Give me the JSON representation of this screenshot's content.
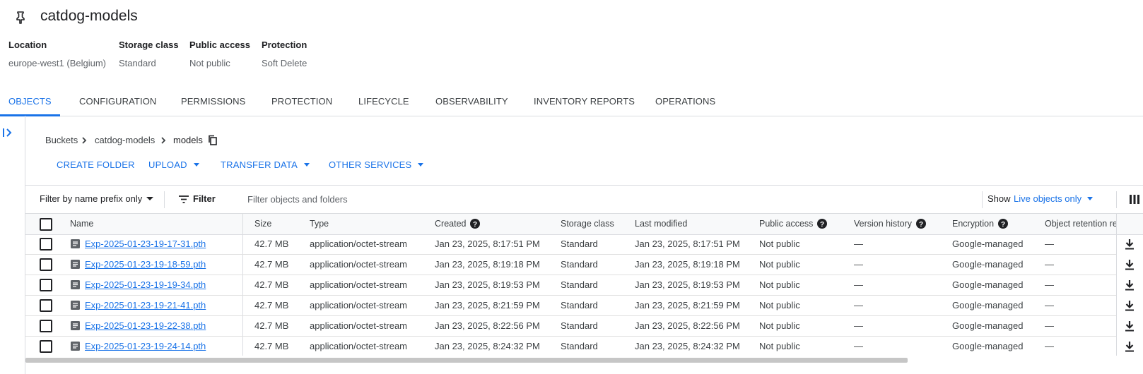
{
  "bucket": {
    "name": "catdog-models",
    "meta": [
      {
        "label": "Location",
        "value": "europe-west1 (Belgium)"
      },
      {
        "label": "Storage class",
        "value": "Standard"
      },
      {
        "label": "Public access",
        "value": "Not public"
      },
      {
        "label": "Protection",
        "value": "Soft Delete"
      }
    ]
  },
  "tabs": [
    "OBJECTS",
    "CONFIGURATION",
    "PERMISSIONS",
    "PROTECTION",
    "LIFECYCLE",
    "OBSERVABILITY",
    "INVENTORY REPORTS",
    "OPERATIONS"
  ],
  "active_tab": "OBJECTS",
  "breadcrumb": [
    "Buckets",
    "catdog-models",
    "models"
  ],
  "actions": {
    "create_folder": "CREATE FOLDER",
    "upload": "UPLOAD",
    "transfer_data": "TRANSFER DATA",
    "other_services": "OTHER SERVICES"
  },
  "filterbar": {
    "prefix_mode": "Filter by name prefix only",
    "filter_label": "Filter",
    "placeholder": "Filter objects and folders",
    "show_label": "Show",
    "show_value": "Live objects only"
  },
  "table": {
    "columns": [
      "Name",
      "Size",
      "Type",
      "Created",
      "Storage class",
      "Last modified",
      "Public access",
      "Version history",
      "Encryption",
      "Object retention re"
    ],
    "rows": [
      {
        "name": "Exp-2025-01-23-19-17-31.pth",
        "size": "42.7 MB",
        "type": "application/octet-stream",
        "created": "Jan 23, 2025, 8:17:51 PM",
        "storage_class": "Standard",
        "last_modified": "Jan 23, 2025, 8:17:51 PM",
        "public_access": "Not public",
        "version_history": "—",
        "encryption": "Google-managed",
        "retention": "—"
      },
      {
        "name": "Exp-2025-01-23-19-18-59.pth",
        "size": "42.7 MB",
        "type": "application/octet-stream",
        "created": "Jan 23, 2025, 8:19:18 PM",
        "storage_class": "Standard",
        "last_modified": "Jan 23, 2025, 8:19:18 PM",
        "public_access": "Not public",
        "version_history": "—",
        "encryption": "Google-managed",
        "retention": "—"
      },
      {
        "name": "Exp-2025-01-23-19-19-34.pth",
        "size": "42.7 MB",
        "type": "application/octet-stream",
        "created": "Jan 23, 2025, 8:19:53 PM",
        "storage_class": "Standard",
        "last_modified": "Jan 23, 2025, 8:19:53 PM",
        "public_access": "Not public",
        "version_history": "—",
        "encryption": "Google-managed",
        "retention": "—"
      },
      {
        "name": "Exp-2025-01-23-19-21-41.pth",
        "size": "42.7 MB",
        "type": "application/octet-stream",
        "created": "Jan 23, 2025, 8:21:59 PM",
        "storage_class": "Standard",
        "last_modified": "Jan 23, 2025, 8:21:59 PM",
        "public_access": "Not public",
        "version_history": "—",
        "encryption": "Google-managed",
        "retention": "—"
      },
      {
        "name": "Exp-2025-01-23-19-22-38.pth",
        "size": "42.7 MB",
        "type": "application/octet-stream",
        "created": "Jan 23, 2025, 8:22:56 PM",
        "storage_class": "Standard",
        "last_modified": "Jan 23, 2025, 8:22:56 PM",
        "public_access": "Not public",
        "version_history": "—",
        "encryption": "Google-managed",
        "retention": "—"
      },
      {
        "name": "Exp-2025-01-23-19-24-14.pth",
        "size": "42.7 MB",
        "type": "application/octet-stream",
        "created": "Jan 23, 2025, 8:24:32 PM",
        "storage_class": "Standard",
        "last_modified": "Jan 23, 2025, 8:24:32 PM",
        "public_access": "Not public",
        "version_history": "—",
        "encryption": "Google-managed",
        "retention": "—"
      }
    ]
  },
  "icons": {
    "bucket": "pin-icon",
    "file": "file-icon",
    "download": "download-icon",
    "help": "help-icon",
    "columns": "column-display-icon",
    "filter": "filter-icon",
    "copy": "copy-icon",
    "expand": "expand-panel-icon"
  },
  "colors": {
    "accent": "#1a73e8",
    "text": "#202124",
    "muted": "#5f6368",
    "border": "#dadce0"
  }
}
